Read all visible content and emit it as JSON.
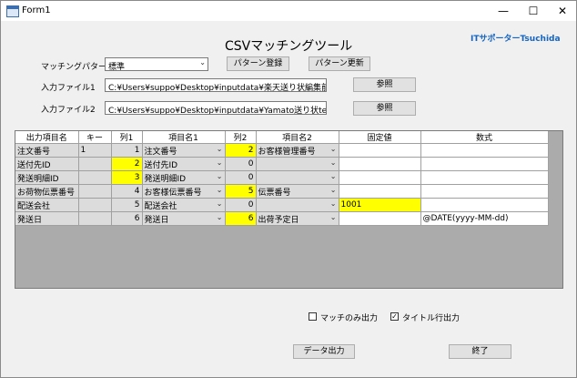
{
  "window": {
    "title": "Form1",
    "minimize": "—",
    "maximize": "☐",
    "close": "✕"
  },
  "header": {
    "title": "CSVマッチングツール",
    "brand": "ITサポーターTsuchida"
  },
  "pattern": {
    "label": "マッチングパターン",
    "value": "標準",
    "register_label": "パターン登録",
    "update_label": "パターン更新"
  },
  "file1": {
    "label": "入力ファイル1",
    "value": "C:¥Users¥suppo¥Desktop¥inputdata¥楽天送り状編集前.csv",
    "browse_label": "参照"
  },
  "file2": {
    "label": "入力ファイル2",
    "value": "C:¥Users¥suppo¥Desktop¥inputdata¥Yamato送り状test.csv",
    "browse_label": "参照"
  },
  "grid": {
    "columns": [
      "出力項目名",
      "キー",
      "列1",
      "項目名1",
      "列2",
      "項目名2",
      "固定値",
      "数式"
    ],
    "rows": [
      {
        "name": "注文番号",
        "key": "1",
        "col1": "1",
        "item1": "注文番号",
        "col2": "2",
        "item2": "お客様管理番号",
        "fixed": "",
        "formula": ""
      },
      {
        "name": "送付先ID",
        "key": "",
        "col1": "2",
        "item1": "送付先ID",
        "col2": "0",
        "item2": "",
        "fixed": "",
        "formula": ""
      },
      {
        "name": "発送明細ID",
        "key": "",
        "col1": "3",
        "item1": "発送明細ID",
        "col2": "0",
        "item2": "",
        "fixed": "",
        "formula": ""
      },
      {
        "name": "お荷物伝票番号",
        "key": "",
        "col1": "4",
        "item1": "お客様伝票番号",
        "col2": "5",
        "item2": "伝票番号",
        "fixed": "",
        "formula": ""
      },
      {
        "name": "配送会社",
        "key": "",
        "col1": "5",
        "item1": "配送会社",
        "col2": "0",
        "item2": "",
        "fixed": "1001",
        "formula": ""
      },
      {
        "name": "発送日",
        "key": "",
        "col1": "6",
        "item1": "発送日",
        "col2": "6",
        "item2": "出荷予定日",
        "fixed": "",
        "formula": "@DATE(yyyy-MM-dd)"
      }
    ]
  },
  "options": {
    "match_only_label": "マッチのみ出力",
    "match_only_checked": false,
    "title_row_label": "タイトル行出力",
    "title_row_checked": true
  },
  "actions": {
    "export_label": "データ出力",
    "exit_label": "終了"
  }
}
